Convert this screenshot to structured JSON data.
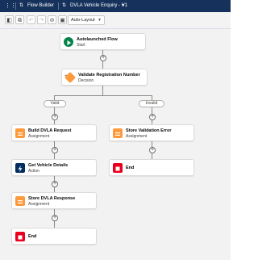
{
  "header": {
    "title": "Flow Builder",
    "flow_name": "DVLA Vehicle Enquiry - V1"
  },
  "toolbar": {
    "layout_select": "Auto-Layout"
  },
  "nodes": {
    "start": {
      "title": "Autolaunched Flow",
      "subtitle": "Start"
    },
    "decision": {
      "title": "Validate Registration Number",
      "subtitle": "Decision"
    },
    "build": {
      "title": "Build DVLA Request",
      "subtitle": "Assignment"
    },
    "action": {
      "title": "Get Vehicle Details",
      "subtitle": "Action"
    },
    "store_resp": {
      "title": "Store DVLA Response",
      "subtitle": "Assignment"
    },
    "end_left": {
      "title": "End"
    },
    "store_err": {
      "title": "Store Validation Error",
      "subtitle": "Assignment"
    },
    "end_right": {
      "title": "End"
    }
  },
  "branches": {
    "valid": "Valid",
    "invalid": "Invalid"
  },
  "colors": {
    "header": "#16325c",
    "start": "#04844b",
    "decision": "#ff9a3c",
    "assignment": "#ff9a3c",
    "action": "#032d60",
    "end": "#ea001e"
  }
}
